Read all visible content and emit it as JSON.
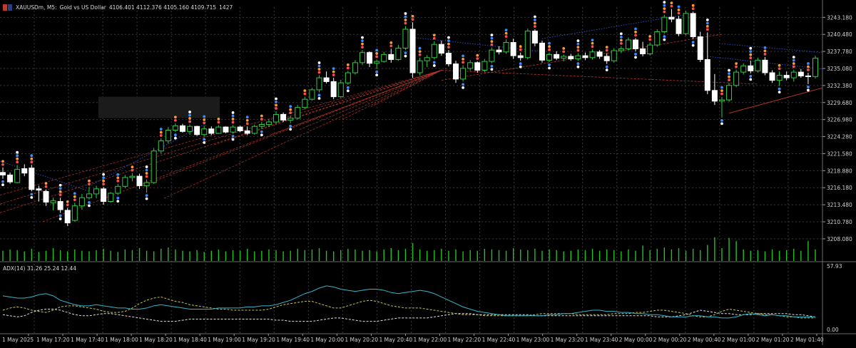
{
  "header": {
    "symbol": "XAUUSDm, M5:",
    "description": "Gold vs US Dollar",
    "ohlc": "4106.401 4112.376 4105.160 4109.715",
    "volume": "1427"
  },
  "indicator": {
    "label": "ADX(14) 31.26 25.24 12.44",
    "scale_top": "57.93",
    "scale_bottom": "0.00"
  },
  "price_axis": [
    "3243.180",
    "3240.480",
    "3237.780",
    "3235.080",
    "3232.380",
    "3229.680",
    "3226.980",
    "3224.280",
    "3221.580",
    "3218.880",
    "3216.180",
    "3213.480",
    "3210.780",
    "3208.080"
  ],
  "time_axis": [
    "1 May 2025",
    "1 May 17:20",
    "1 May 17:40",
    "1 May 18:00",
    "1 May 18:20",
    "1 May 18:40",
    "1 May 19:00",
    "1 May 19:20",
    "1 May 19:40",
    "1 May 20:00",
    "1 May 20:20",
    "1 May 20:40",
    "1 May 22:00",
    "1 May 22:20",
    "1 May 22:40",
    "1 May 23:00",
    "1 May 23:20",
    "1 May 23:40",
    "2 May 00:00",
    "2 May 00:20",
    "2 May 00:40",
    "2 May 01:00",
    "2 May 01:20",
    "2 May 01:40"
  ],
  "colors": {
    "background": "#000000",
    "grid": "#3a3a3a",
    "bull_body": "#000000",
    "bull_border": "#2ecc40",
    "bear_body": "#ffffff",
    "bear_border": "#ffffff",
    "volume": "#22c222",
    "adx_main": "#35b5c9",
    "adx_plus": "#c8c850",
    "adx_minus": "#e0e0e0",
    "trend_red": "#c0392b",
    "trend_blue": "#2d4fd6",
    "marker_red": "#ff4d4d",
    "marker_orange": "#ff9933",
    "marker_blue": "#3a8dff",
    "marker_white": "#ffffff"
  },
  "chart_data": {
    "type": "candlestick",
    "timeframe": "M5",
    "y_range": [
      3206.6,
      3244.8
    ],
    "candles": [
      [
        3218.6,
        3219.4,
        3217.6,
        3218.2
      ],
      [
        3218.2,
        3218.6,
        3216.8,
        3217.1
      ],
      [
        3217.0,
        3219.8,
        3216.9,
        3219.1
      ],
      [
        3219.2,
        3219.9,
        3218.0,
        3218.5
      ],
      [
        3219.3,
        3219.8,
        3215.6,
        3215.9
      ],
      [
        3216.0,
        3216.5,
        3214.0,
        3215.8
      ],
      [
        3215.6,
        3215.9,
        3213.3,
        3213.9
      ],
      [
        3213.8,
        3214.6,
        3212.6,
        3214.1
      ],
      [
        3214.0,
        3214.6,
        3212.2,
        3212.7
      ],
      [
        3212.6,
        3213.0,
        3210.1,
        3210.6
      ],
      [
        3211.0,
        3213.8,
        3210.8,
        3213.3
      ],
      [
        3213.3,
        3215.2,
        3212.7,
        3214.6
      ],
      [
        3214.6,
        3216.3,
        3214.3,
        3215.2
      ],
      [
        3215.2,
        3216.5,
        3214.5,
        3216.0
      ],
      [
        3216.0,
        3216.3,
        3213.5,
        3214.0
      ],
      [
        3214.0,
        3215.5,
        3213.8,
        3215.3
      ],
      [
        3215.3,
        3216.8,
        3215.0,
        3216.4
      ],
      [
        3216.4,
        3218.2,
        3216.1,
        3217.8
      ],
      [
        3217.8,
        3218.5,
        3217.2,
        3218.0
      ],
      [
        3218.0,
        3218.4,
        3216.0,
        3216.5
      ],
      [
        3216.5,
        3217.5,
        3215.4,
        3217.0
      ],
      [
        3217.0,
        3222.5,
        3216.8,
        3222.0
      ],
      [
        3222.0,
        3224.0,
        3221.6,
        3223.6
      ],
      [
        3223.6,
        3225.8,
        3223.2,
        3225.3
      ],
      [
        3225.3,
        3226.4,
        3225.0,
        3226.0
      ],
      [
        3226.0,
        3226.3,
        3224.9,
        3225.1
      ],
      [
        3225.1,
        3226.2,
        3224.6,
        3225.9
      ],
      [
        3225.9,
        3226.0,
        3224.4,
        3224.6
      ],
      [
        3224.6,
        3226.0,
        3224.3,
        3225.5
      ],
      [
        3225.5,
        3225.9,
        3224.5,
        3224.8
      ],
      [
        3224.8,
        3226.1,
        3224.7,
        3225.8
      ],
      [
        3225.8,
        3225.9,
        3224.8,
        3225.0
      ],
      [
        3225.0,
        3226.1,
        3224.8,
        3225.8
      ],
      [
        3225.8,
        3226.0,
        3225.0,
        3225.2
      ],
      [
        3225.2,
        3225.9,
        3224.5,
        3224.8
      ],
      [
        3224.8,
        3226.2,
        3224.6,
        3225.9
      ],
      [
        3225.9,
        3226.6,
        3225.5,
        3226.2
      ],
      [
        3226.2,
        3227.0,
        3225.8,
        3226.6
      ],
      [
        3226.6,
        3228.3,
        3226.3,
        3227.8
      ],
      [
        3227.8,
        3228.1,
        3226.6,
        3226.9
      ],
      [
        3226.9,
        3227.6,
        3226.4,
        3227.2
      ],
      [
        3227.2,
        3229.3,
        3227.0,
        3228.9
      ],
      [
        3228.9,
        3230.6,
        3228.6,
        3230.2
      ],
      [
        3230.2,
        3232.0,
        3230.0,
        3231.7
      ],
      [
        3231.7,
        3234.0,
        3231.3,
        3233.6
      ],
      [
        3233.6,
        3234.6,
        3232.7,
        3233.0
      ],
      [
        3233.0,
        3233.6,
        3230.2,
        3230.6
      ],
      [
        3230.6,
        3233.3,
        3230.4,
        3232.8
      ],
      [
        3232.8,
        3234.7,
        3232.5,
        3234.4
      ],
      [
        3234.4,
        3236.4,
        3234.1,
        3236.0
      ],
      [
        3236.0,
        3238.0,
        3235.6,
        3237.6
      ],
      [
        3237.6,
        3237.8,
        3235.3,
        3235.9
      ],
      [
        3235.9,
        3236.5,
        3235.0,
        3236.2
      ],
      [
        3236.2,
        3237.7,
        3236.0,
        3237.3
      ],
      [
        3237.3,
        3238.2,
        3236.0,
        3236.5
      ],
      [
        3236.5,
        3238.8,
        3236.3,
        3238.3
      ],
      [
        3238.3,
        3241.8,
        3238.0,
        3241.3
      ],
      [
        3241.3,
        3242.4,
        3233.6,
        3234.4
      ],
      [
        3234.4,
        3236.8,
        3234.0,
        3236.3
      ],
      [
        3236.3,
        3237.2,
        3235.3,
        3236.8
      ],
      [
        3236.8,
        3239.4,
        3236.5,
        3238.9
      ],
      [
        3238.9,
        3239.5,
        3237.1,
        3237.5
      ],
      [
        3237.5,
        3238.0,
        3235.4,
        3235.8
      ],
      [
        3235.8,
        3236.3,
        3232.8,
        3233.4
      ],
      [
        3233.4,
        3235.6,
        3233.0,
        3235.1
      ],
      [
        3235.1,
        3236.4,
        3234.7,
        3236.0
      ],
      [
        3236.0,
        3236.2,
        3234.4,
        3234.8
      ],
      [
        3234.8,
        3236.6,
        3234.5,
        3236.2
      ],
      [
        3236.2,
        3238.4,
        3235.9,
        3238.0
      ],
      [
        3238.0,
        3238.6,
        3237.3,
        3237.7
      ],
      [
        3237.7,
        3239.7,
        3237.4,
        3239.2
      ],
      [
        3239.2,
        3239.8,
        3236.6,
        3237.1
      ],
      [
        3237.1,
        3237.6,
        3236.3,
        3236.8
      ],
      [
        3236.8,
        3241.4,
        3236.5,
        3241.0
      ],
      [
        3241.0,
        3241.3,
        3238.6,
        3239.1
      ],
      [
        3239.1,
        3239.5,
        3236.0,
        3236.4
      ],
      [
        3236.4,
        3237.6,
        3236.1,
        3237.3
      ],
      [
        3237.3,
        3237.8,
        3236.4,
        3236.7
      ],
      [
        3236.7,
        3237.3,
        3236.2,
        3237.0
      ],
      [
        3237.0,
        3237.4,
        3236.3,
        3236.6
      ],
      [
        3236.6,
        3237.5,
        3236.3,
        3237.1
      ],
      [
        3237.1,
        3237.6,
        3236.4,
        3236.8
      ],
      [
        3236.8,
        3238.1,
        3236.5,
        3237.7
      ],
      [
        3237.7,
        3238.0,
        3236.6,
        3237.0
      ],
      [
        3237.0,
        3237.5,
        3235.8,
        3236.3
      ],
      [
        3236.3,
        3238.3,
        3236.0,
        3237.9
      ],
      [
        3237.9,
        3238.6,
        3237.5,
        3238.2
      ],
      [
        3238.2,
        3240.0,
        3237.9,
        3239.6
      ],
      [
        3239.6,
        3239.9,
        3237.8,
        3238.2
      ],
      [
        3238.2,
        3239.3,
        3237.0,
        3237.4
      ],
      [
        3237.4,
        3239.2,
        3237.1,
        3238.8
      ],
      [
        3238.8,
        3241.3,
        3238.5,
        3240.9
      ],
      [
        3240.9,
        3243.6,
        3240.6,
        3243.2
      ],
      [
        3243.2,
        3244.5,
        3242.4,
        3242.9
      ],
      [
        3242.9,
        3243.4,
        3240.2,
        3240.6
      ],
      [
        3240.6,
        3244.2,
        3240.3,
        3243.8
      ],
      [
        3243.8,
        3244.1,
        3239.7,
        3240.1
      ],
      [
        3240.1,
        3240.9,
        3236.1,
        3236.5
      ],
      [
        3236.5,
        3240.8,
        3231.0,
        3231.6
      ],
      [
        3231.6,
        3234.2,
        3229.3,
        3229.9
      ],
      [
        3229.9,
        3230.6,
        3227.3,
        3230.1
      ],
      [
        3230.1,
        3232.8,
        3229.8,
        3232.4
      ],
      [
        3232.4,
        3234.9,
        3232.1,
        3234.5
      ],
      [
        3234.5,
        3235.9,
        3234.1,
        3235.5
      ],
      [
        3235.5,
        3236.3,
        3234.3,
        3234.7
      ],
      [
        3234.7,
        3236.8,
        3234.4,
        3236.4
      ],
      [
        3236.4,
        3236.9,
        3234.0,
        3234.4
      ],
      [
        3234.4,
        3234.8,
        3232.8,
        3233.2
      ],
      [
        3233.2,
        3234.6,
        3232.3,
        3234.0
      ],
      [
        3234.0,
        3234.6,
        3233.2,
        3233.6
      ],
      [
        3233.6,
        3234.9,
        3233.0,
        3234.5
      ],
      [
        3234.5,
        3235.0,
        3233.6,
        3233.9
      ],
      [
        3233.9,
        3234.4,
        3232.6,
        3233.8
      ],
      [
        3233.8,
        3237.1,
        3233.5,
        3236.7
      ]
    ],
    "volume": [
      16,
      18,
      17,
      15,
      19,
      14,
      16,
      20,
      17,
      15,
      18,
      16,
      15,
      17,
      19,
      16,
      14,
      18,
      17,
      20,
      16,
      15,
      19,
      21,
      18,
      16,
      15,
      17,
      14,
      16,
      18,
      15,
      17,
      16,
      19,
      15,
      16,
      18,
      17,
      15,
      16,
      19,
      17,
      18,
      20,
      16,
      15,
      17,
      19,
      18,
      16,
      17,
      15,
      18,
      20,
      17,
      19,
      28,
      18,
      16,
      17,
      19,
      16,
      18,
      15,
      17,
      16,
      19,
      18,
      17,
      16,
      20,
      18,
      17,
      19,
      16,
      18,
      17,
      15,
      16,
      18,
      17,
      19,
      16,
      18,
      17,
      15,
      18,
      16,
      24,
      17,
      19,
      21,
      18,
      20,
      16,
      19,
      17,
      25,
      37,
      20,
      36,
      31,
      18,
      16,
      17,
      15,
      18,
      16,
      17,
      19,
      16,
      31,
      18
    ],
    "adx": {
      "main": [
        31,
        30,
        29,
        29,
        30,
        32,
        33,
        31,
        27,
        25,
        23,
        22,
        22,
        23,
        22,
        21,
        20,
        20,
        19,
        19,
        20,
        22,
        23,
        22,
        21,
        20,
        19,
        19,
        19,
        19,
        20,
        20,
        20,
        20,
        21,
        21,
        22,
        22,
        23,
        25,
        27,
        30,
        33,
        35,
        38,
        40,
        39,
        37,
        36,
        35,
        36,
        37,
        37,
        36,
        34,
        33,
        34,
        35,
        36,
        35,
        33,
        30,
        27,
        24,
        21,
        19,
        17,
        16,
        15,
        14,
        13,
        13,
        13,
        13,
        13,
        13,
        14,
        14,
        15,
        15,
        16,
        17,
        18,
        18,
        17,
        17,
        16,
        16,
        15,
        15,
        14,
        14,
        13,
        12,
        12,
        12,
        13,
        13,
        12,
        12,
        11,
        11,
        12,
        14,
        15,
        14,
        13,
        14,
        13,
        13,
        12,
        12,
        12,
        12
      ],
      "plus": [
        18,
        20,
        21,
        20,
        18,
        17,
        16,
        18,
        21,
        22,
        22,
        21,
        20,
        19,
        17,
        16,
        16,
        17,
        20,
        24,
        27,
        29,
        30,
        28,
        26,
        25,
        23,
        22,
        21,
        20,
        19,
        19,
        18,
        18,
        18,
        18,
        18,
        19,
        21,
        23,
        24,
        25,
        26,
        26,
        24,
        22,
        20,
        20,
        22,
        24,
        26,
        27,
        26,
        24,
        22,
        21,
        20,
        20,
        20,
        19,
        18,
        17,
        16,
        15,
        14,
        14,
        14,
        13,
        13,
        13,
        13,
        13,
        13,
        13,
        14,
        15,
        15,
        15,
        15,
        15,
        14,
        14,
        14,
        14,
        14,
        15,
        15,
        15,
        16,
        16,
        17,
        18,
        18,
        17,
        16,
        15,
        13,
        12,
        12,
        14,
        17,
        19,
        18,
        17,
        16,
        15,
        14,
        14,
        13,
        12,
        12,
        11,
        11,
        11
      ],
      "minus": [
        14,
        13,
        12,
        13,
        16,
        18,
        19,
        19,
        18,
        16,
        14,
        13,
        13,
        14,
        15,
        15,
        14,
        13,
        12,
        11,
        10,
        9,
        8,
        8,
        8,
        9,
        10,
        10,
        10,
        10,
        10,
        10,
        10,
        10,
        10,
        10,
        10,
        10,
        9,
        9,
        8,
        8,
        8,
        8,
        9,
        10,
        11,
        11,
        10,
        9,
        8,
        8,
        8,
        9,
        10,
        11,
        11,
        11,
        11,
        11,
        12,
        13,
        14,
        15,
        15,
        15,
        14,
        14,
        14,
        14,
        14,
        14,
        14,
        14,
        13,
        13,
        13,
        13,
        13,
        13,
        13,
        13,
        13,
        13,
        13,
        13,
        13,
        13,
        13,
        13,
        13,
        12,
        12,
        12,
        13,
        14,
        16,
        18,
        17,
        16,
        15,
        15,
        14,
        14,
        14,
        15,
        15,
        15,
        15,
        15,
        14,
        14,
        13,
        12
      ]
    }
  }
}
